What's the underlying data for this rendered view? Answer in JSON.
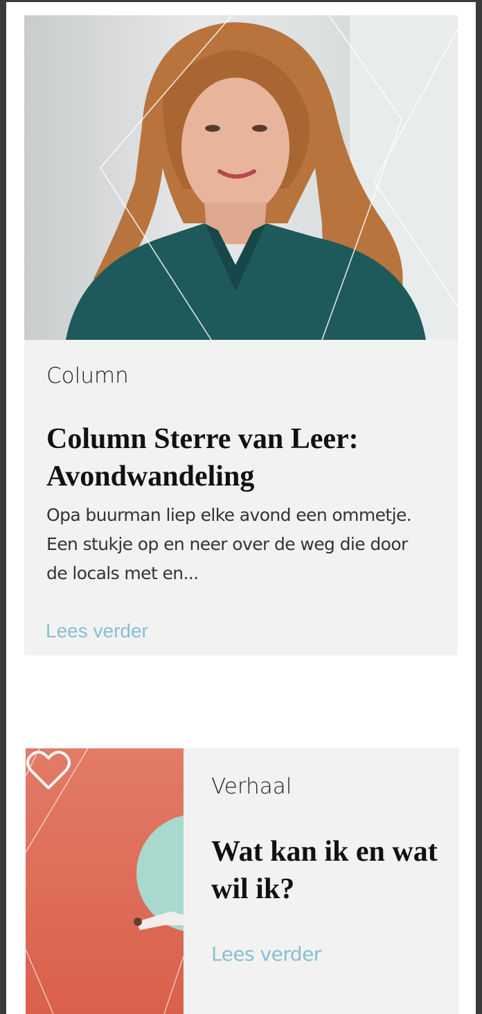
{
  "articles": [
    {
      "category": "Column",
      "title_line1": "Column Sterre van Leer:",
      "title_line2": "Avondwandeling",
      "excerpt_line1": "Opa buurman liep elke avond een ommetje.",
      "excerpt_line2": "Een stukje op en neer over de weg die door",
      "excerpt_line3": "de locals met en...",
      "read_more": "Lees verder",
      "image_icon": "portrait-photo"
    },
    {
      "category": "Verhaal",
      "title_line1": "Wat kan ik en wat",
      "title_line2": "wil ik?",
      "read_more": "Lees verder",
      "image_icon": "illustration-photo",
      "favorite_icon": "heart-icon"
    }
  ],
  "colors": {
    "card_background": "#f2f2f2",
    "link": "#87bfd0",
    "thumb_coral": "#e27b67",
    "accent_mint": "#a9d8cf"
  }
}
